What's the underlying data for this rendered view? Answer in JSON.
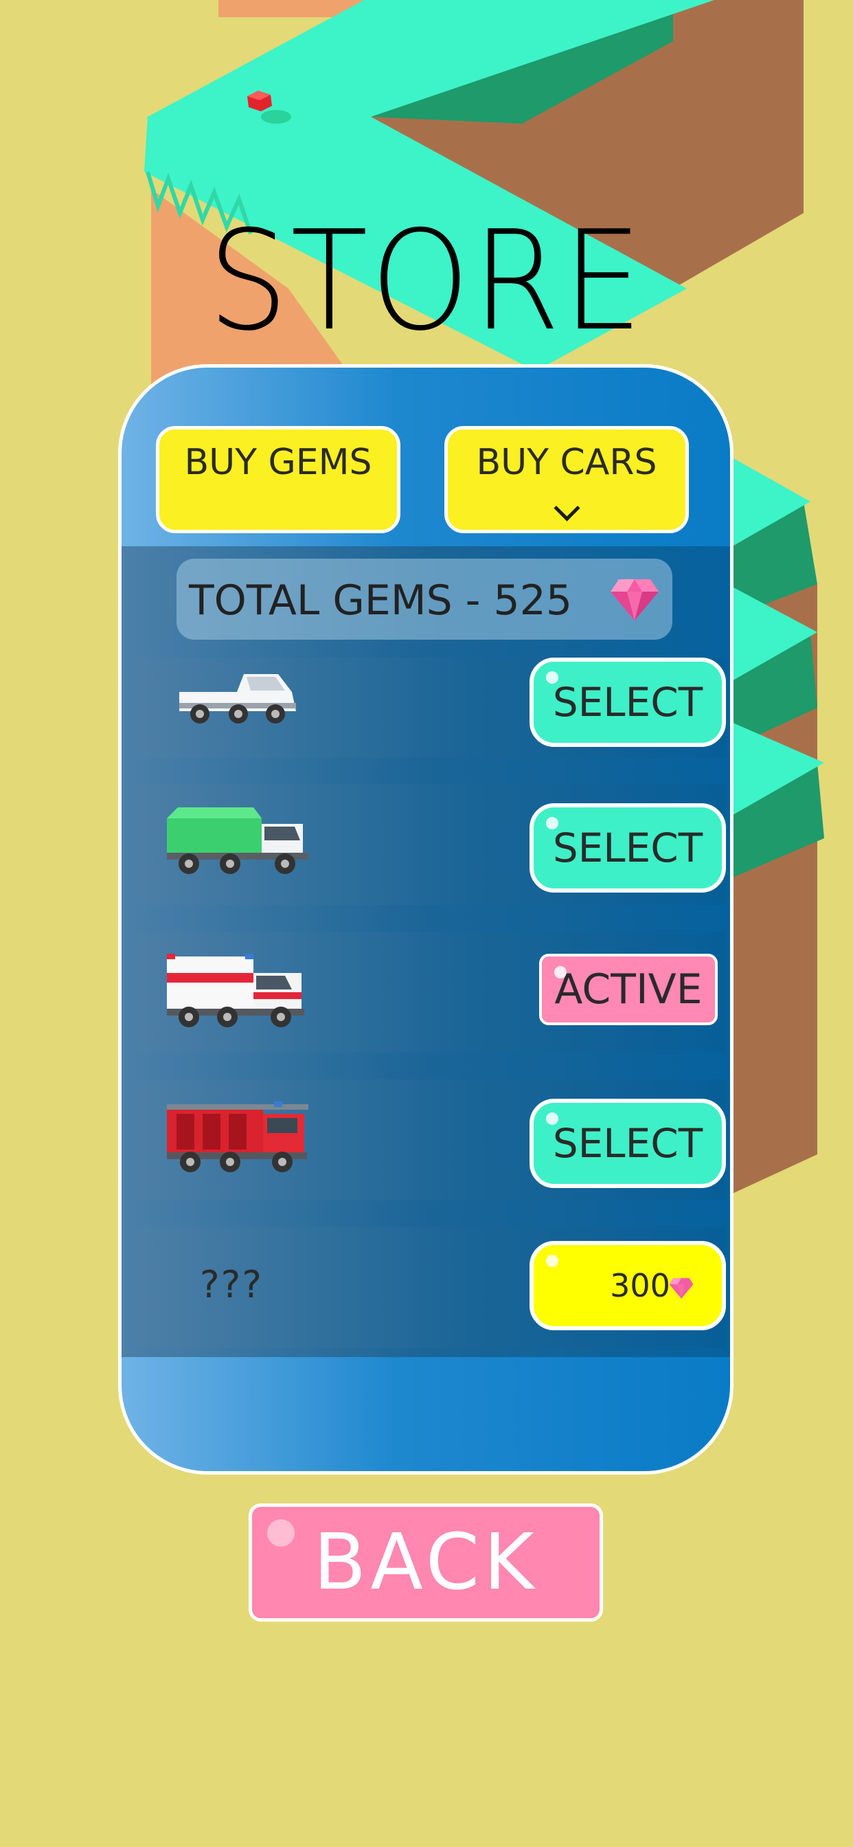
{
  "title": "STORE",
  "tabs": {
    "buy_gems": "BUY GEMS",
    "buy_cars": "BUY CARS",
    "active_tab_indicator": "chevron-down-icon"
  },
  "total_gems": {
    "text": "TOTAL GEMS - 525",
    "icon": "gem-icon"
  },
  "cars": [
    {
      "vehicle": "pickup-truck-icon",
      "button": "SELECT",
      "state": "select"
    },
    {
      "vehicle": "garbage-truck-icon",
      "button": "SELECT",
      "state": "select"
    },
    {
      "vehicle": "ambulance-icon",
      "button": "ACTIVE",
      "state": "active"
    },
    {
      "vehicle": "fire-truck-icon",
      "button": "SELECT",
      "state": "select"
    },
    {
      "vehicle": "locked",
      "name": "???",
      "price": "300",
      "price_icon": "gem-icon",
      "state": "buy"
    }
  ],
  "back_button": "BACK",
  "colors": {
    "background": "#e3d977",
    "path_top": "#3df3c8",
    "select_button": "#3ef0c7",
    "active_button": "#ff89b2",
    "price_button": "#ffff00",
    "tab_button": "#fbf021",
    "panel_blue": "#0a7bc6",
    "gem_pink": "#f45da3"
  }
}
